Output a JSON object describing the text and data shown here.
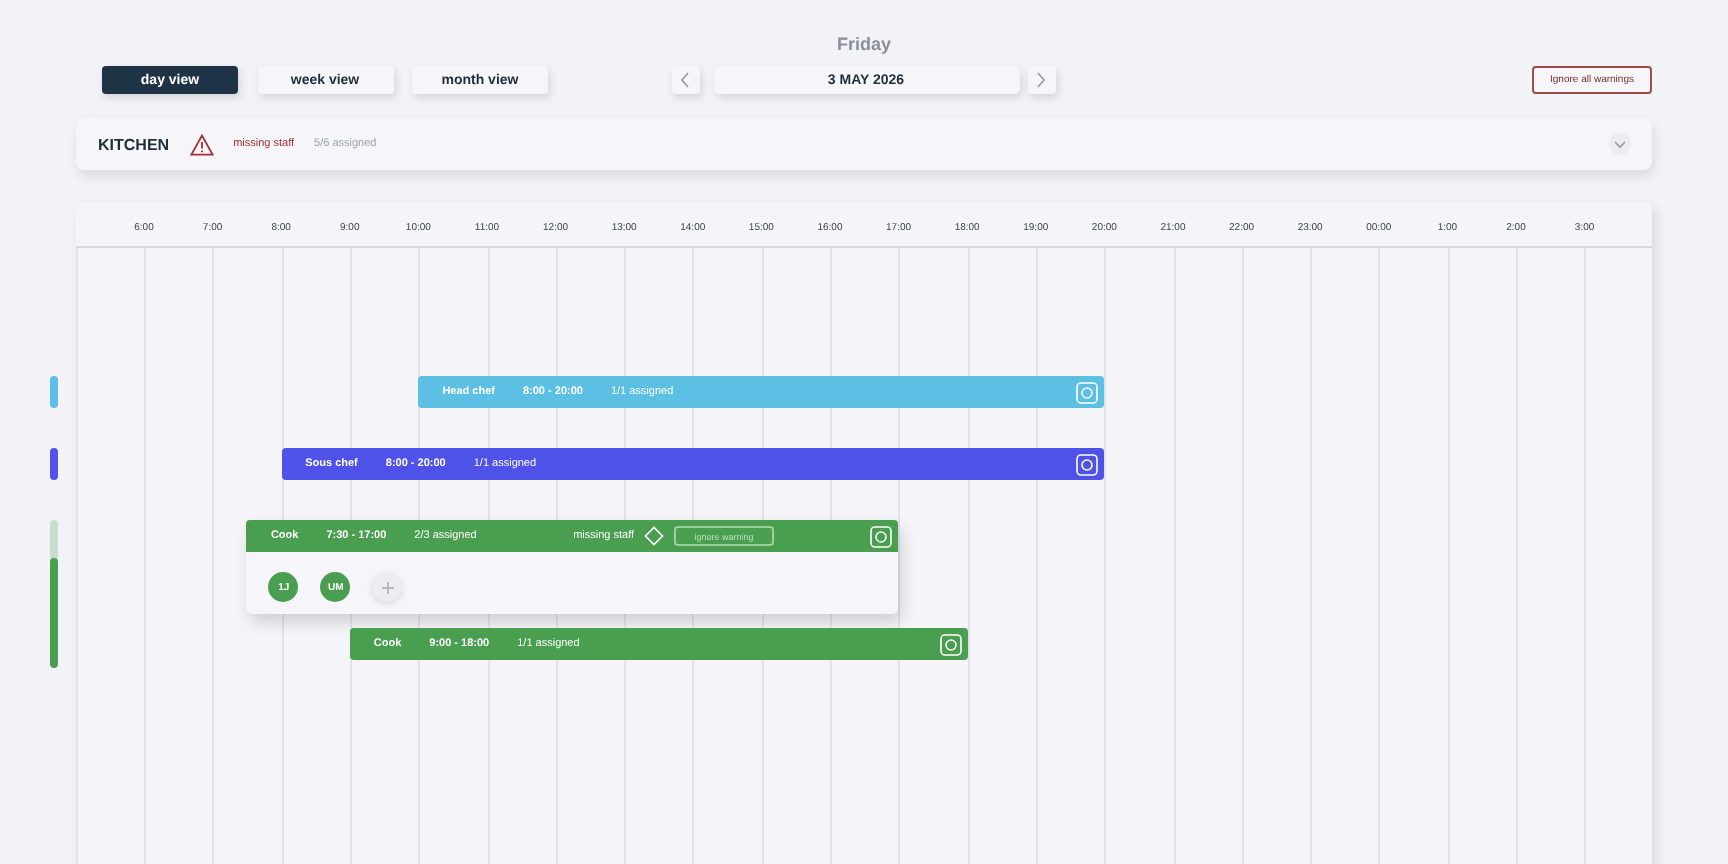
{
  "day_label": "Friday",
  "view_tabs": [
    {
      "label": "day view",
      "selected": true
    },
    {
      "label": "week view",
      "selected": false
    },
    {
      "label": "month view",
      "selected": false
    }
  ],
  "date": "3 MAY 2026",
  "ignore_all_button": "Ignore all warnings",
  "section": {
    "title": "KITCHEN",
    "warning": "missing staff",
    "assigned": "5/6 assigned"
  },
  "hours": [
    "6:00",
    "7:00",
    "8:00",
    "9:00",
    "10:00",
    "11:00",
    "12:00",
    "13:00",
    "14:00",
    "15:00",
    "16:00",
    "17:00",
    "18:00",
    "19:00",
    "20:00",
    "21:00",
    "22:00",
    "23:00",
    "00:00",
    "1:00",
    "2:00",
    "3:00"
  ],
  "shifts": [
    {
      "role": "Head chef",
      "time": "8:00 - 20:00",
      "assigned": "1/1 assigned",
      "color": "#5bc0e3",
      "expanded": false
    },
    {
      "role": "Sous chef",
      "time": "8:00 - 20:00",
      "assigned": "1/1 assigned",
      "color": "#4f52e8",
      "expanded": false
    },
    {
      "role": "Cook",
      "time": "7:30 - 17:00",
      "assigned": "2/3 assigned",
      "color": "#4a9e4f",
      "expanded": true,
      "warning": "missing staff",
      "ignore_button": "ignore warning",
      "staff": [
        "1J",
        "UM"
      ]
    },
    {
      "role": "Cook",
      "time": "9:00 - 18:00",
      "assigned": "1/1 assigned",
      "color": "#4a9e4f",
      "expanded": false
    }
  ]
}
